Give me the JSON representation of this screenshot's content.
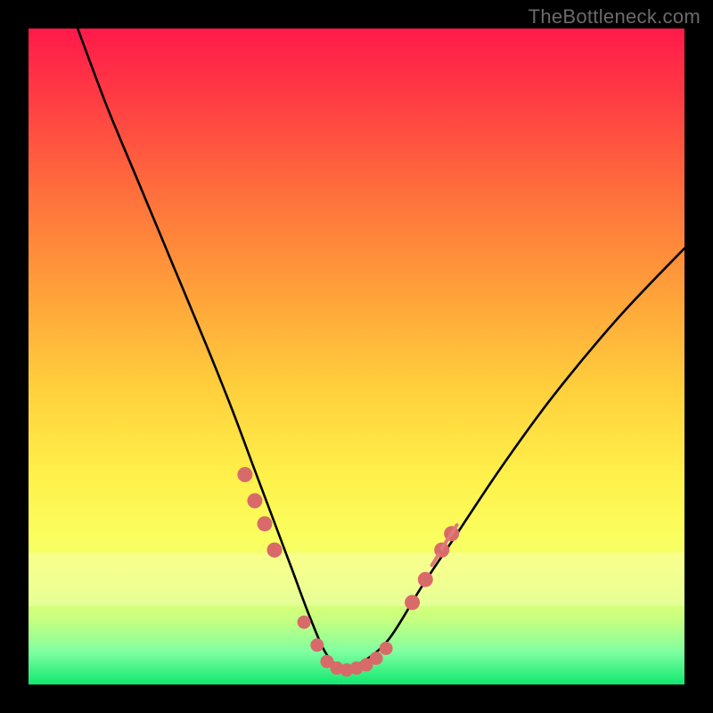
{
  "watermark": "TheBottleneck.com",
  "colors": {
    "curve": "#000000",
    "dot": "#d96a6a"
  },
  "chart_data": {
    "type": "line",
    "title": "",
    "xlabel": "",
    "ylabel": "",
    "xlim": [
      0,
      1
    ],
    "ylim": [
      0,
      1
    ],
    "note": "Axes unlabeled; values are normalized positions within the plot area (0 = left/top of plot box, 1 = right/bottom). Curve is a V-shaped dip reaching near the bottom around x≈0.48; background gradient encodes height (red=high, green=low).",
    "series": [
      {
        "name": "curve",
        "x": [
          0.075,
          0.12,
          0.17,
          0.22,
          0.27,
          0.31,
          0.34,
          0.37,
          0.4,
          0.43,
          0.455,
          0.48,
          0.51,
          0.55,
          0.6,
          0.65,
          0.72,
          0.8,
          0.9,
          1.0
        ],
        "y": [
          0.0,
          0.12,
          0.24,
          0.36,
          0.48,
          0.58,
          0.66,
          0.74,
          0.82,
          0.9,
          0.955,
          0.975,
          0.965,
          0.93,
          0.85,
          0.775,
          0.67,
          0.56,
          0.44,
          0.335
        ]
      }
    ],
    "markers": {
      "name": "highlighted-points",
      "note": "Salmon dots clustered along the curve near the trough and on both flanks just above it.",
      "x": [
        0.33,
        0.345,
        0.36,
        0.375,
        0.42,
        0.44,
        0.455,
        0.47,
        0.485,
        0.5,
        0.515,
        0.53,
        0.545,
        0.585,
        0.605,
        0.63,
        0.645
      ],
      "y": [
        0.68,
        0.72,
        0.755,
        0.795,
        0.905,
        0.94,
        0.965,
        0.975,
        0.978,
        0.975,
        0.97,
        0.96,
        0.945,
        0.875,
        0.84,
        0.795,
        0.77
      ]
    },
    "tick_dashes_right": {
      "note": "Short pink dashes along right ascending limb (decorative artifacts in source image).",
      "x": [
        0.62,
        0.635,
        0.648
      ],
      "y": [
        0.81,
        0.785,
        0.765
      ]
    }
  }
}
